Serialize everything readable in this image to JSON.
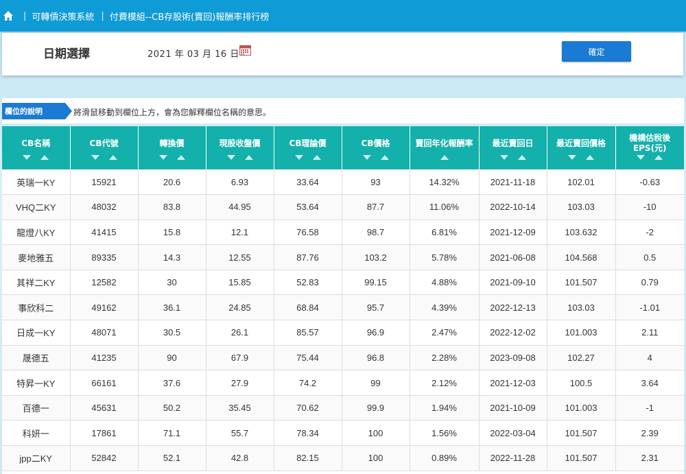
{
  "breadcrumb": {
    "home_icon": "home-icon",
    "items": [
      "可轉債決策系統",
      "付費模組--CB存股術(賣回)報酬率排行榜"
    ]
  },
  "date_panel": {
    "title": "日期選擇",
    "date_value": "2021 年 03 月 16 日",
    "calendar_icon": "calendar-icon",
    "confirm_label": "確定"
  },
  "description": {
    "tag": "欄位的說明",
    "text": "將滑鼠移動到欄位上方，會為您解釋欄位名稱的意思。"
  },
  "colors": {
    "topbar": "#0f9bd6",
    "header": "#14b0ab",
    "button": "#1a7ad4"
  },
  "table": {
    "columns": [
      {
        "label": "CB名稱",
        "sort": "both"
      },
      {
        "label": "CB代號",
        "sort": "both"
      },
      {
        "label": "轉換價",
        "sort": "both"
      },
      {
        "label": "現股收盤價",
        "sort": "both"
      },
      {
        "label": "CB理論價",
        "sort": "both"
      },
      {
        "label": "CB價格",
        "sort": "both"
      },
      {
        "label": "賣回年化報酬率",
        "sort": "up"
      },
      {
        "label": "最近賣回日",
        "sort": "both"
      },
      {
        "label": "最近賣回價格",
        "sort": "both"
      },
      {
        "label": "機構估稅後EPS(元)",
        "sort": "both"
      }
    ],
    "rows": [
      [
        "英瑞一KY",
        "15921",
        "20.6",
        "6.93",
        "33.64",
        "93",
        "14.32%",
        "2021-11-18",
        "102.01",
        "-0.63"
      ],
      [
        "VHQ二KY",
        "48032",
        "83.8",
        "44.95",
        "53.64",
        "87.7",
        "11.06%",
        "2022-10-14",
        "103.03",
        "-10"
      ],
      [
        "龍燈八KY",
        "41415",
        "15.8",
        "12.1",
        "76.58",
        "98.7",
        "6.81%",
        "2021-12-09",
        "103.632",
        "-2"
      ],
      [
        "麥地雅五",
        "89335",
        "14.3",
        "12.55",
        "87.76",
        "103.2",
        "5.78%",
        "2021-06-08",
        "104.568",
        "0.5"
      ],
      [
        "其祥二KY",
        "12582",
        "30",
        "15.85",
        "52.83",
        "99.15",
        "4.88%",
        "2021-09-10",
        "101.507",
        "0.79"
      ],
      [
        "事欣科二",
        "49162",
        "36.1",
        "24.85",
        "68.84",
        "95.7",
        "4.39%",
        "2022-12-13",
        "103.03",
        "-1.01"
      ],
      [
        "日成一KY",
        "48071",
        "30.5",
        "26.1",
        "85.57",
        "96.9",
        "2.47%",
        "2022-12-02",
        "101.003",
        "2.11"
      ],
      [
        "晟德五",
        "41235",
        "90",
        "67.9",
        "75.44",
        "96.8",
        "2.28%",
        "2023-09-08",
        "102.27",
        "4"
      ],
      [
        "特昇一KY",
        "66161",
        "37.6",
        "27.9",
        "74.2",
        "99",
        "2.12%",
        "2021-12-03",
        "100.5",
        "3.64"
      ],
      [
        "百德一",
        "45631",
        "50.2",
        "35.45",
        "70.62",
        "99.9",
        "1.94%",
        "2021-10-09",
        "101.003",
        "-1"
      ],
      [
        "科妍一",
        "17861",
        "71.1",
        "55.7",
        "78.34",
        "100",
        "1.56%",
        "2022-03-04",
        "101.507",
        "2.39"
      ],
      [
        "jpp二KY",
        "52842",
        "52.1",
        "42.8",
        "82.15",
        "100",
        "0.89%",
        "2022-11-28",
        "101.507",
        "2.31"
      ]
    ]
  }
}
